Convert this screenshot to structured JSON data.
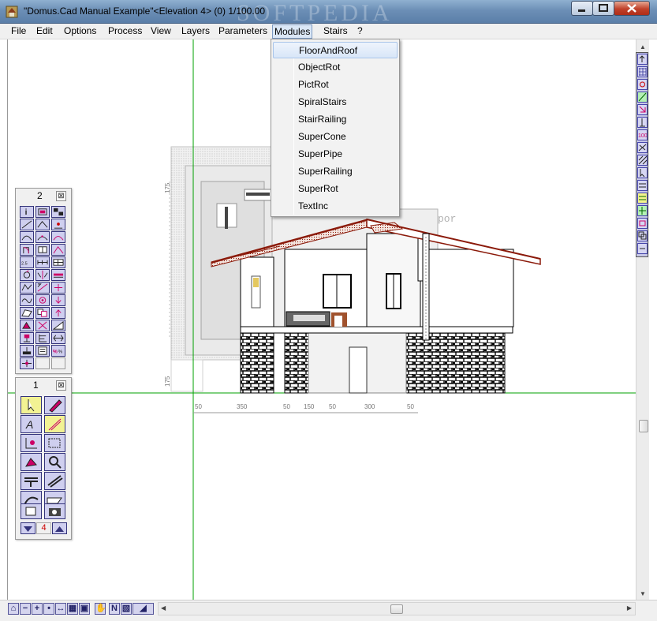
{
  "window": {
    "title": "\"Domus.Cad Manual Example\"<Elevation 4> (0) 1/100.00",
    "watermark": "SOFTPEDIA",
    "buttons": {
      "minimize": "minimize",
      "maximize": "maximize",
      "close": "close"
    }
  },
  "menubar": {
    "items": [
      {
        "label": "File"
      },
      {
        "label": "Edit"
      },
      {
        "label": "Options"
      },
      {
        "label": "Process"
      },
      {
        "label": "View"
      },
      {
        "label": "Layers"
      },
      {
        "label": "Parameters"
      },
      {
        "label": "Modules"
      },
      {
        "label": "Stairs"
      },
      {
        "label": "?"
      }
    ],
    "active": "Modules"
  },
  "modules_menu": {
    "items": [
      {
        "label": "FloorAndRoof"
      },
      {
        "label": "ObjectRot"
      },
      {
        "label": "PictRot"
      },
      {
        "label": "SpiralStairs"
      },
      {
        "label": "StairRailing"
      },
      {
        "label": "SuperCone"
      },
      {
        "label": "SuperPipe"
      },
      {
        "label": "SuperRailing"
      },
      {
        "label": "SuperRot"
      },
      {
        "label": "TextInc"
      }
    ],
    "highlighted": "FloorAndRoof"
  },
  "palette_2": {
    "title": "2",
    "close": "⊠"
  },
  "palette_1": {
    "title": "1",
    "close": "⊠",
    "layer_number": "4"
  },
  "drawing": {
    "dimensions": [
      "50",
      "350",
      "50",
      "150",
      "50",
      "300",
      "50"
    ],
    "vertical_dims": [
      "175",
      "175"
    ],
    "background_text": "por"
  },
  "colors": {
    "axis_green": "#00a000",
    "roof_red": "#8b1a0a",
    "tool_purple": "#cfcfef",
    "menu_highlight": "#dbe7f6"
  }
}
